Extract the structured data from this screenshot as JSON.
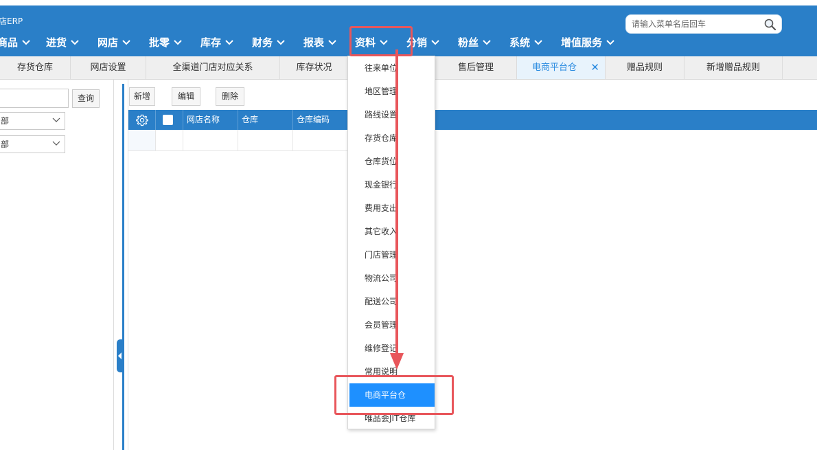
{
  "app": {
    "title": "店ERP"
  },
  "search": {
    "placeholder": "请输入菜单名后回车"
  },
  "menu": {
    "items": [
      {
        "label": "商品"
      },
      {
        "label": "进货"
      },
      {
        "label": "网店"
      },
      {
        "label": "批零"
      },
      {
        "label": "库存"
      },
      {
        "label": "财务"
      },
      {
        "label": "报表"
      },
      {
        "label": "资料"
      },
      {
        "label": "分销"
      },
      {
        "label": "粉丝"
      },
      {
        "label": "系统"
      },
      {
        "label": "增值服务"
      }
    ]
  },
  "tabs": [
    {
      "label": "存货仓库"
    },
    {
      "label": "网店设置"
    },
    {
      "label": "全渠道门店对应关系"
    },
    {
      "label": "库存状况"
    },
    {
      "label": "售后管理"
    },
    {
      "label": "电商平台仓"
    },
    {
      "label": "赠品规则"
    },
    {
      "label": "新增赠品规则"
    }
  ],
  "left": {
    "query_label": "查询",
    "select1_value": "部",
    "select2_value": "部"
  },
  "toolbar": {
    "add": "新增",
    "edit": "编辑",
    "delete": "删除"
  },
  "grid": {
    "columns": [
      "网店名称",
      "仓库",
      "仓库编码"
    ]
  },
  "dropdown": {
    "items": [
      {
        "label": "往来单位"
      },
      {
        "label": "地区管理"
      },
      {
        "label": "路线设置"
      },
      {
        "label": "存货仓库"
      },
      {
        "label": "仓库货位"
      },
      {
        "label": "现金银行"
      },
      {
        "label": "费用支出"
      },
      {
        "label": "其它收入"
      },
      {
        "label": "门店管理"
      },
      {
        "label": "物流公司"
      },
      {
        "label": "配送公司"
      },
      {
        "label": "会员管理"
      },
      {
        "label": "维修登记"
      },
      {
        "label": "常用说明"
      },
      {
        "label": "电商平台仓"
      },
      {
        "label": "唯品会JIT仓库"
      }
    ],
    "active_index": 14
  },
  "colors": {
    "brand": "#2a7fc8",
    "highlight": "#e8565b",
    "active_item": "#1e90ff"
  }
}
